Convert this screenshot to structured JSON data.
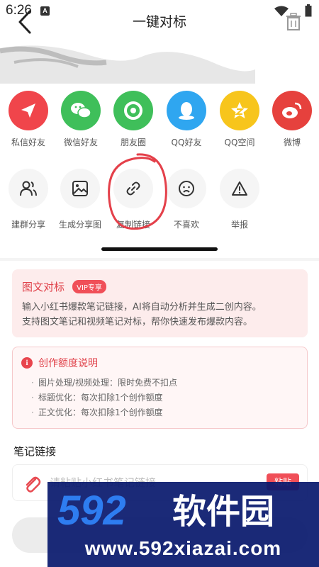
{
  "status": {
    "time": "6:26",
    "notif_badge": "A"
  },
  "header": {
    "title": "一键对标"
  },
  "share_row": [
    {
      "label": "私信好友",
      "icon": "send-icon",
      "color": "#f0454b"
    },
    {
      "label": "微信好友",
      "icon": "wechat-icon",
      "color": "#3fbf5a"
    },
    {
      "label": "朋友圈",
      "icon": "moments-icon",
      "color": "#3fbf5a"
    },
    {
      "label": "QQ好友",
      "icon": "qq-icon",
      "color": "#2fa6f0"
    },
    {
      "label": "QQ空间",
      "icon": "qzone-icon",
      "color": "#f7c51c"
    },
    {
      "label": "微博",
      "icon": "weibo-icon",
      "color": "#e6413d"
    }
  ],
  "action_row": [
    {
      "label": "建群分享",
      "icon": "group-icon"
    },
    {
      "label": "生成分享图",
      "icon": "image-icon"
    },
    {
      "label": "复制链接",
      "icon": "link-icon"
    },
    {
      "label": "不喜欢",
      "icon": "dislike-face-icon"
    },
    {
      "label": "举报",
      "icon": "report-icon"
    }
  ],
  "feature": {
    "title": "图文对标",
    "vip": "VIP专享",
    "desc1": "输入小红书爆款笔记链接，AI将自动分析并生成二创内容。",
    "desc2": "支持图文笔记和视频笔记对标，帮你快速发布爆款内容。"
  },
  "quota": {
    "title": "创作额度说明",
    "items": [
      "图片处理/视频处理：限时免费不扣点",
      "标题优化：每次扣除1个创作额度",
      "正文优化：每次扣除1个创作额度"
    ]
  },
  "link_section": {
    "label": "笔记链接",
    "placeholder": "请粘贴小红书笔记链接",
    "paste_label": "粘贴"
  },
  "watermark": {
    "logo_text": "592软件园",
    "url": "www.592xiazai.com"
  },
  "colors": {
    "accent": "#f04f58",
    "feature_bg": "#fdecec",
    "watermark_bg": "#0a1a6e"
  }
}
